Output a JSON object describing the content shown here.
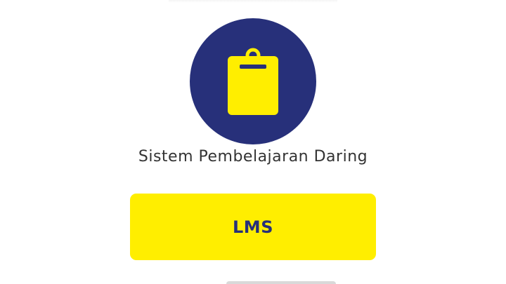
{
  "app": {
    "subtitle": "Sistem Pembelajaran Daring"
  },
  "icon": {
    "name": "clipboard-icon",
    "circle_color": "#27307a",
    "icon_color": "#ffee00"
  },
  "lms_button": {
    "label": "LMS",
    "background": "#ffee00",
    "text_color": "#27307a"
  }
}
